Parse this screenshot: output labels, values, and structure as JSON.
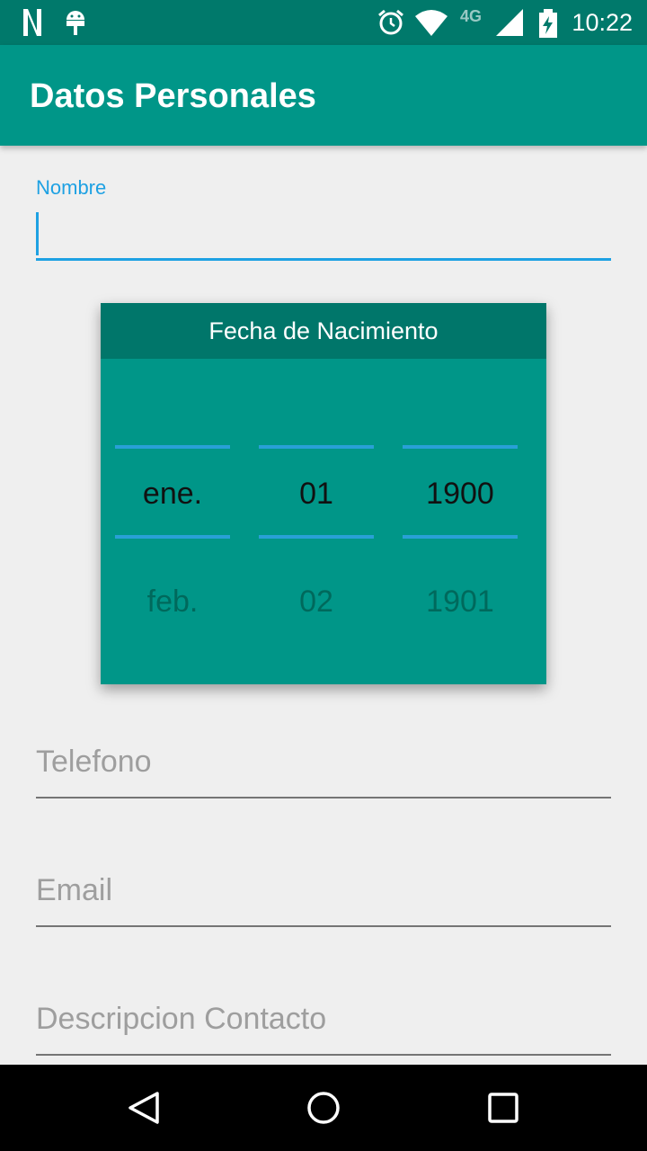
{
  "status_bar": {
    "time": "10:22",
    "network": "4G",
    "icons": [
      "netflix-icon",
      "android-icon",
      "alarm-icon",
      "wifi-icon",
      "signal-icon",
      "battery-charging-icon"
    ]
  },
  "app_bar": {
    "title": "Datos Personales"
  },
  "form": {
    "name_label": "Nombre",
    "name_value": "",
    "date_picker": {
      "title": "Fecha de Nacimiento",
      "month": {
        "selected": "ene.",
        "next": "feb."
      },
      "day": {
        "selected": "01",
        "next": "02"
      },
      "year": {
        "selected": "1900",
        "next": "1901"
      }
    },
    "phone_placeholder": "Telefono",
    "email_placeholder": "Email",
    "description_placeholder": "Descripcion Contacto"
  },
  "nav_bar": {
    "buttons": [
      "back-icon",
      "home-icon",
      "recents-icon"
    ]
  },
  "colors": {
    "primary": "#009688",
    "primary_dark": "#00796b",
    "accent": "#1ea1e3"
  }
}
